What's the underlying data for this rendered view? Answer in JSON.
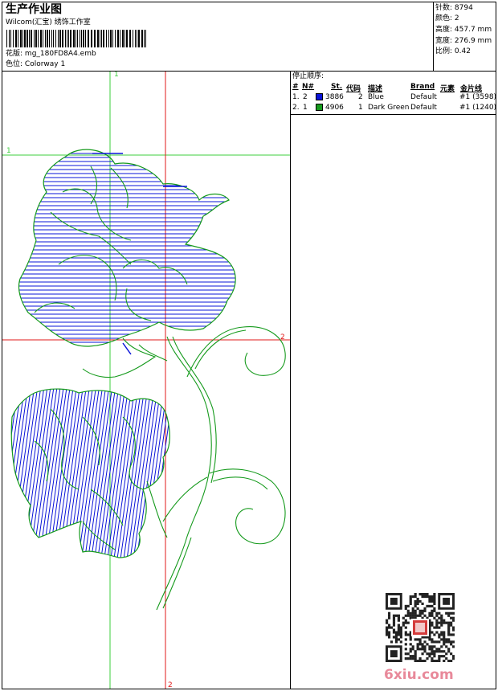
{
  "header": {
    "title": "生产作业图",
    "company": "Wilcom(汇宝) 绣饰工作室",
    "design_label": "花版:",
    "design_value": "mg_180FD8A4.emb",
    "colorway_label": "色位:",
    "colorway_value": "Colorway 1"
  },
  "stats": [
    {
      "label": "针数:",
      "value": "8794"
    },
    {
      "label": "颜色:",
      "value": "2"
    },
    {
      "label": "高度:",
      "value": "457.7 mm"
    },
    {
      "label": "宽度:",
      "value": "276.9 mm"
    },
    {
      "label": "比例:",
      "value": "0.42"
    }
  ],
  "stop_sequence": {
    "title": "停止顺序:",
    "columns": [
      "#",
      "N#",
      "St.",
      "代码",
      "描述",
      "Brand",
      "元素",
      "金片线"
    ],
    "rows": [
      {
        "index": "1.",
        "n": "2",
        "color": "#0a14d8",
        "stitches": "3886",
        "code": "2",
        "desc": "Blue",
        "brand": "Default",
        "sequin": "#1 (3598)"
      },
      {
        "index": "2.",
        "n": "1",
        "color": "#159a1c",
        "stitches": "4906",
        "code": "1",
        "desc": "Dark Green",
        "brand": "Default",
        "sequin": "#1 (1240)"
      }
    ]
  },
  "guides": {
    "v1_label": "1",
    "h1_label": "1",
    "h2_label": "2",
    "v2_label": "2"
  },
  "watermark": "6xiu.com",
  "colors": {
    "blue": "#0a14d8",
    "green": "#159a1c",
    "guide_green": "#3ecf3e",
    "guide_red": "#e01818"
  }
}
